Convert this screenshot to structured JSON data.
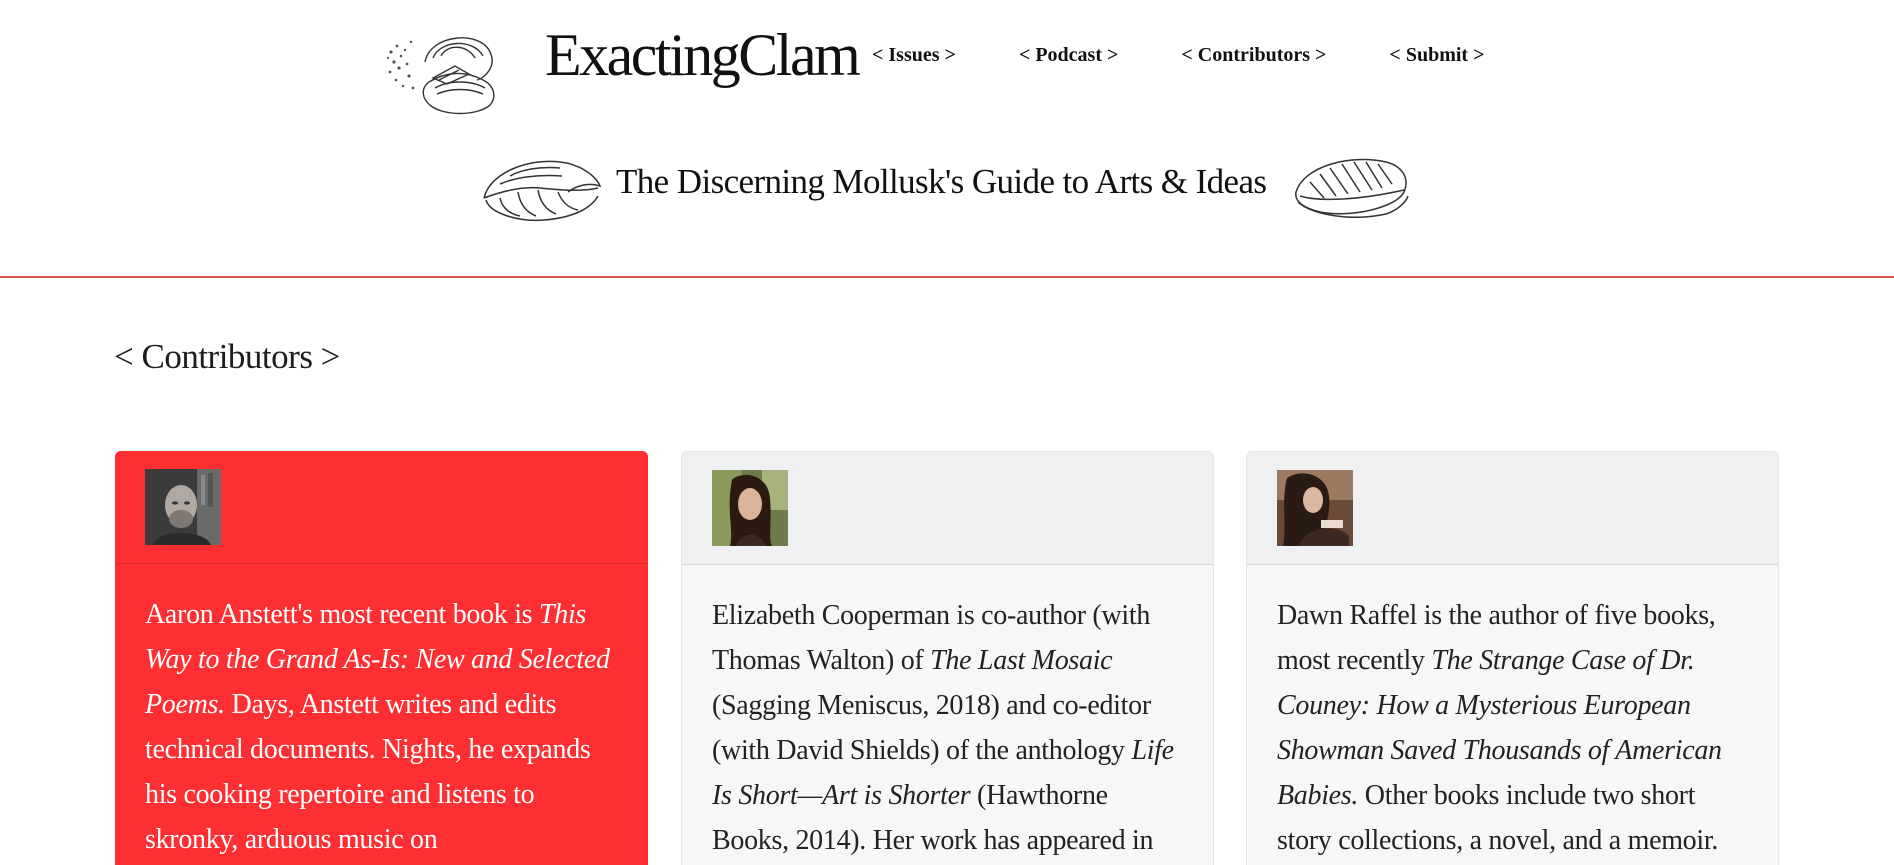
{
  "site": {
    "logo_text": "ExactingClam",
    "tagline": "The Discerning Mollusk's Guide to Arts & Ideas"
  },
  "nav": {
    "items": [
      {
        "label": "< Issues >"
      },
      {
        "label": "< Podcast >"
      },
      {
        "label": "< Contributors >"
      },
      {
        "label": "< Submit >"
      }
    ]
  },
  "page": {
    "title": "< Contributors >"
  },
  "colors": {
    "accent_red": "#fd2f33",
    "divider": "#d9534f",
    "card_gray": "#f7f7f8"
  },
  "contributors": [
    {
      "name": "Aaron Anstett",
      "bio_parts": [
        {
          "text": "Aaron Anstett's most recent book is ",
          "italic": false
        },
        {
          "text": "This Way to the Grand As-Is: New and Selected Poems.",
          "italic": true
        },
        {
          "text": " Days, Anstett writes and edits technical documents. Nights, he expands his cooking repertoire and listens to skronky, arduous music on",
          "italic": false
        }
      ]
    },
    {
      "name": "Elizabeth Cooperman",
      "bio_parts": [
        {
          "text": "Elizabeth Cooperman is co-author (with Thomas Walton) of ",
          "italic": false
        },
        {
          "text": "The Last Mosaic",
          "italic": true
        },
        {
          "text": " (Sagging Meniscus, 2018) and co-editor (with David Shields) of the anthology ",
          "italic": false
        },
        {
          "text": "Life Is Short—Art is Shorter",
          "italic": true
        },
        {
          "text": " (Hawthorne Books, 2014). Her work has appeared in",
          "italic": false
        }
      ]
    },
    {
      "name": "Dawn Raffel",
      "bio_parts": [
        {
          "text": "Dawn Raffel is the author of five books, most recently ",
          "italic": false
        },
        {
          "text": "The Strange Case of Dr. Couney: How a Mysterious European Showman Saved Thousands of American Babies.",
          "italic": true
        },
        {
          "text": " Other books include two short story collections, a novel, and a memoir.",
          "italic": false
        }
      ]
    }
  ]
}
